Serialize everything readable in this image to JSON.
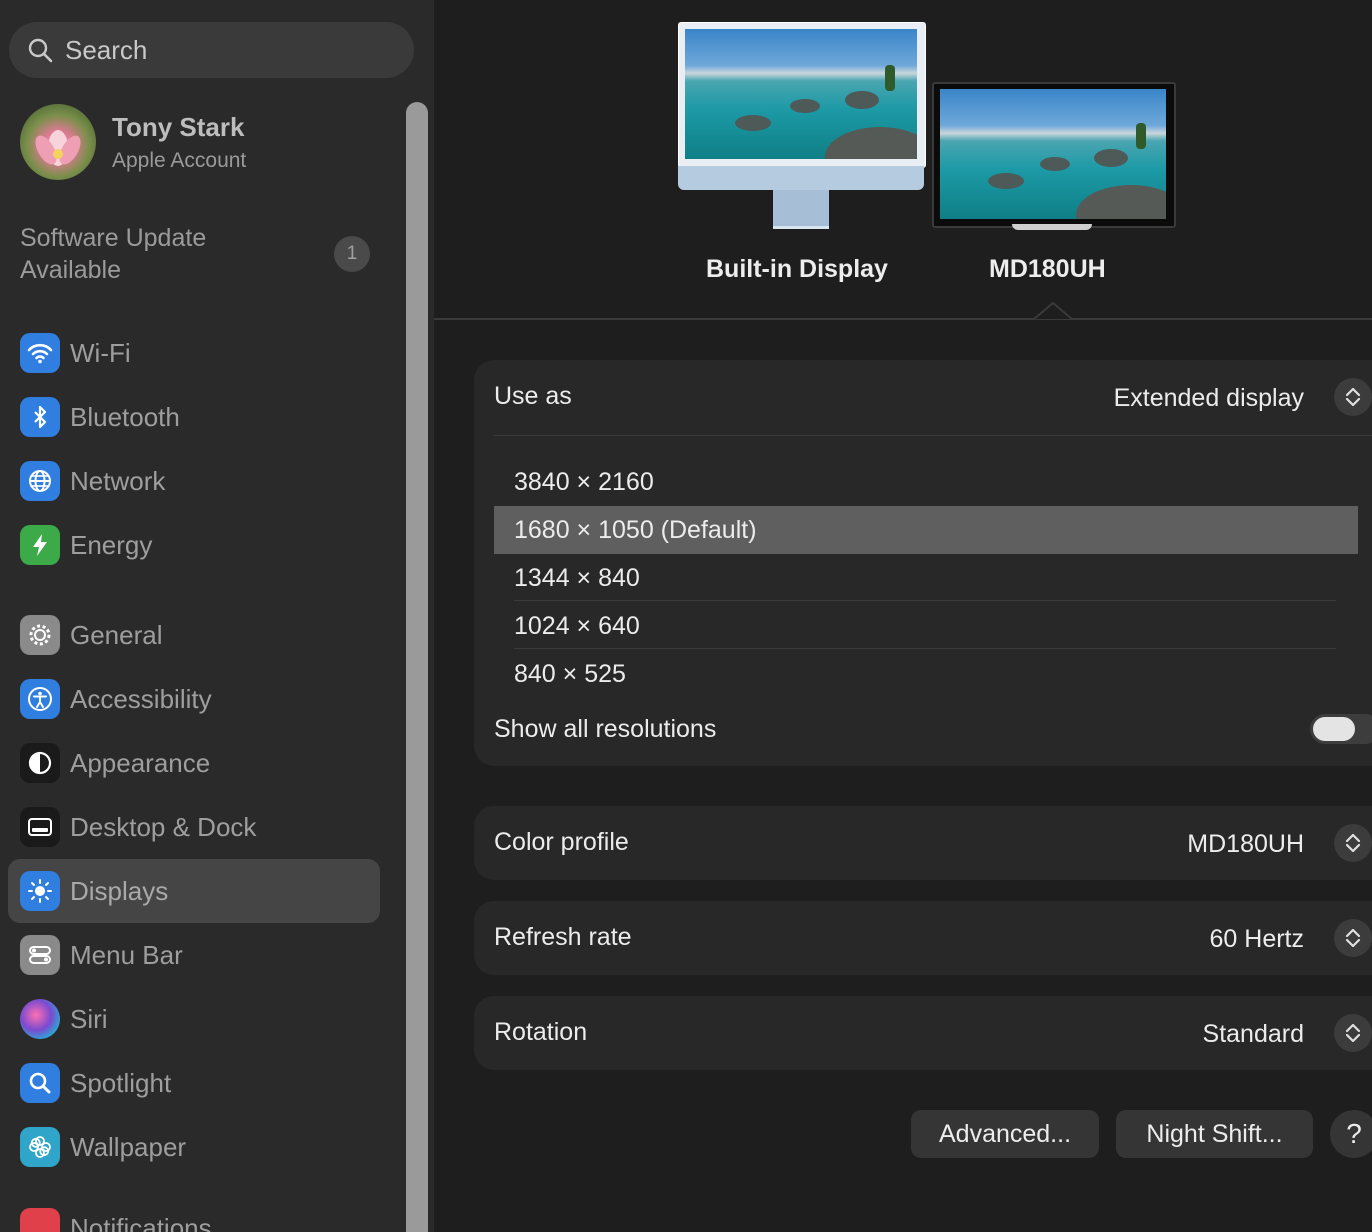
{
  "sidebar": {
    "search_placeholder": "Search",
    "account": {
      "name": "Tony Stark",
      "subtitle": "Apple Account"
    },
    "update": {
      "line1": "Software Update",
      "line2": "Available",
      "badge": "1"
    },
    "items": [
      {
        "label": "Wi-Fi",
        "icon": "wifi-icon",
        "color": "#2f7ee0"
      },
      {
        "label": "Bluetooth",
        "icon": "bluetooth-icon",
        "color": "#2f7ee0"
      },
      {
        "label": "Network",
        "icon": "globe-icon",
        "color": "#2f7ee0"
      },
      {
        "label": "Energy",
        "icon": "bolt-icon",
        "color": "#3daa4a"
      },
      {
        "label": "General",
        "icon": "gear-icon",
        "color": "#8a8a8a"
      },
      {
        "label": "Accessibility",
        "icon": "accessibility-icon",
        "color": "#2f7ee0"
      },
      {
        "label": "Appearance",
        "icon": "appearance-icon",
        "color": "#1a1a1a"
      },
      {
        "label": "Desktop & Dock",
        "icon": "dock-icon",
        "color": "#1a1a1a"
      },
      {
        "label": "Displays",
        "icon": "sun-icon",
        "color": "#2f7ee0",
        "selected": true
      },
      {
        "label": "Menu Bar",
        "icon": "menubar-icon",
        "color": "#8a8a8a"
      },
      {
        "label": "Siri",
        "icon": "siri-icon",
        "color": "#7a4ad0"
      },
      {
        "label": "Spotlight",
        "icon": "spotlight-icon",
        "color": "#2f7ee0"
      },
      {
        "label": "Wallpaper",
        "icon": "flower-icon",
        "color": "#2fa6c9"
      },
      {
        "label": "Notifications",
        "icon": "bell-icon",
        "color": "#e0404a"
      }
    ]
  },
  "displays": {
    "builtin_label": "Built-in Display",
    "external_label": "MD180UH"
  },
  "use_as": {
    "label": "Use as",
    "value": "Extended display"
  },
  "resolutions": {
    "items": [
      "3840 × 2160",
      "1680 × 1050 (Default)",
      "1344 × 840",
      "1024 × 640",
      "840 × 525"
    ],
    "selected_index": 1,
    "show_all_label": "Show all resolutions",
    "show_all_on": false
  },
  "color_profile": {
    "label": "Color profile",
    "value": "MD180UH"
  },
  "refresh_rate": {
    "label": "Refresh rate",
    "value": "60 Hertz"
  },
  "rotation": {
    "label": "Rotation",
    "value": "Standard"
  },
  "buttons": {
    "advanced": "Advanced...",
    "night_shift": "Night Shift...",
    "help": "?"
  }
}
